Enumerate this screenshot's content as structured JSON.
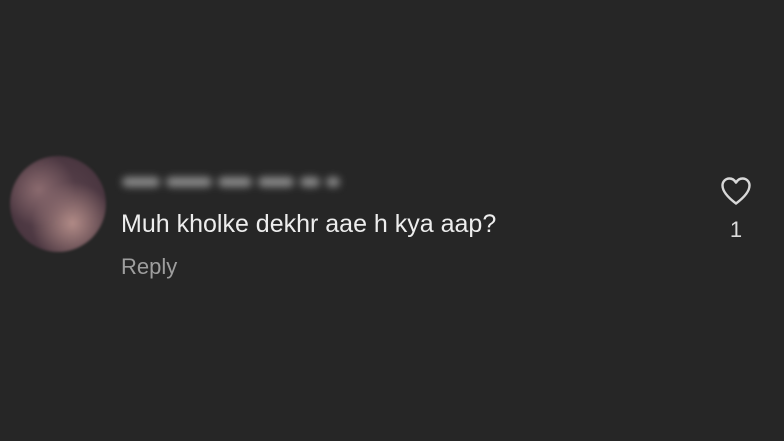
{
  "comment": {
    "text": "Muh kholke dekhr aae h kya aap?",
    "reply_label": "Reply",
    "like_count": "1",
    "icons": {
      "avatar": "blurred-profile-photo",
      "like": "heart-outline-icon"
    }
  },
  "colors": {
    "background": "#262626",
    "comment_text": "#ededed",
    "secondary_text": "#9e9e9e"
  }
}
